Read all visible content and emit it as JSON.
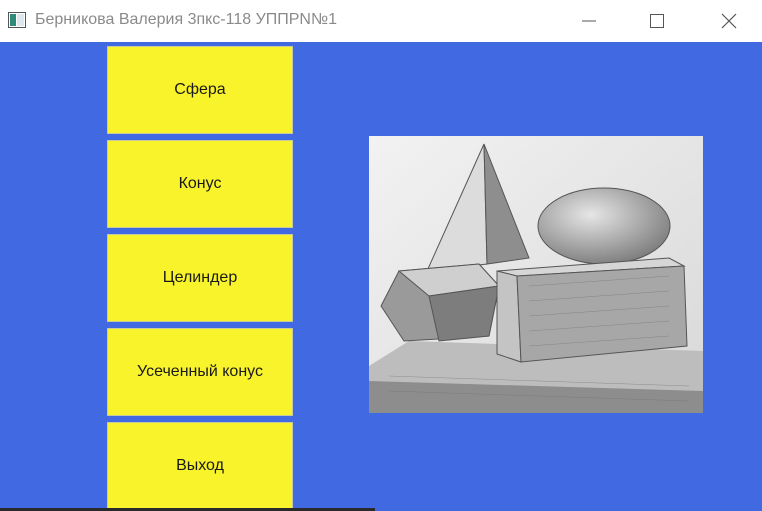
{
  "window": {
    "title": "Берникова Валерия 3пкс-118 УППРN№1"
  },
  "buttons": {
    "sphere": "Сфера",
    "cone": "Конус",
    "cylinder": "Целиндер",
    "truncated_cone": "Усеченный конус",
    "exit": "Выход"
  },
  "colors": {
    "background": "#4169e1",
    "button": "#f8f32b"
  },
  "icons": {
    "app": "app-window-icon",
    "minimize": "minimize-icon",
    "maximize": "maximize-icon",
    "close": "close-icon"
  }
}
